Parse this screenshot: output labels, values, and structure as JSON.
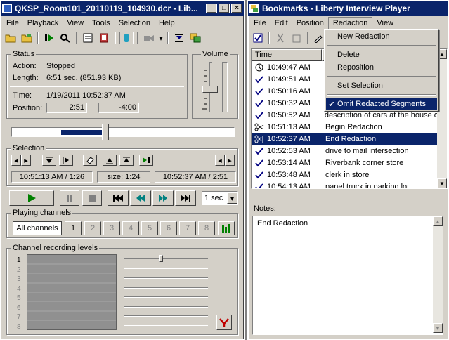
{
  "left_window": {
    "title": "QKSP_Room101_20110119_104930.dcr - Lib...",
    "menu": [
      "File",
      "Playback",
      "View",
      "Tools",
      "Selection",
      "Help"
    ],
    "status": {
      "group_label": "Status",
      "action_label": "Action:",
      "action_value": "Stopped",
      "length_label": "Length:",
      "length_value": "6:51 sec. (851.93 KB)",
      "time_label": "Time:",
      "time_value": "1/19/2011 10:52:37 AM",
      "position_label": "Position:",
      "position_value": "2:51",
      "remaining_value": "-4:00"
    },
    "volume": {
      "group_label": "Volume",
      "level": 0.45
    },
    "timeline": {
      "position_fraction": 0.42,
      "selection_start": 0.22,
      "selection_end": 0.42
    },
    "selection": {
      "group_label": "Selection",
      "start": "10:51:13 AM / 1:26",
      "size": "size: 1:24",
      "end": "10:52:37 AM / 2:51"
    },
    "transport": {
      "step": "1 sec"
    },
    "playing_channels": {
      "group_label": "Playing channels",
      "all_label": "All channels",
      "channels": [
        "1",
        "2",
        "3",
        "4",
        "5",
        "6",
        "7",
        "8"
      ]
    },
    "recording_levels": {
      "group_label": "Channel recording levels",
      "channels": [
        "1",
        "2",
        "3",
        "4",
        "5",
        "6",
        "7",
        "8"
      ]
    }
  },
  "right_window": {
    "title": "Bookmarks - Liberty Interview Player",
    "menu": [
      "File",
      "Edit",
      "Position",
      "Redaction",
      "View"
    ],
    "list_header": {
      "time": "Time"
    },
    "bookmarks": [
      {
        "time": "10:49:47 AM",
        "text": "",
        "icon": "clock-icon"
      },
      {
        "time": "10:49:51 AM",
        "text": "",
        "icon": "check-icon"
      },
      {
        "time": "10:50:16 AM",
        "text": "",
        "icon": "check-icon"
      },
      {
        "time": "10:50:32 AM",
        "text": "",
        "icon": "check-icon"
      },
      {
        "time": "10:50:52 AM",
        "text": "description of cars at the house o",
        "icon": "check-icon"
      },
      {
        "time": "10:51:13 AM",
        "text": "Begin Redaction",
        "icon": "scissors-icon"
      },
      {
        "time": "10:52:37 AM",
        "text": "End Redaction",
        "icon": "scissors-end-icon",
        "selected": true
      },
      {
        "time": "10:52:53 AM",
        "text": "drive to mail intersection",
        "icon": "check-icon"
      },
      {
        "time": "10:53:14 AM",
        "text": "Riverbank corner store",
        "icon": "check-icon"
      },
      {
        "time": "10:53:48 AM",
        "text": "clerk in store",
        "icon": "check-icon"
      },
      {
        "time": "10:54:13 AM",
        "text": "panel truck in parking lot",
        "icon": "check-icon"
      }
    ],
    "redaction_menu": {
      "items": [
        "New Redaction",
        "Delete",
        "Reposition",
        "Set Selection",
        "Omit Redacted Segments"
      ],
      "checked": "Omit Redacted Segments"
    },
    "notes": {
      "label": "Notes:",
      "text": "End Redaction"
    }
  }
}
